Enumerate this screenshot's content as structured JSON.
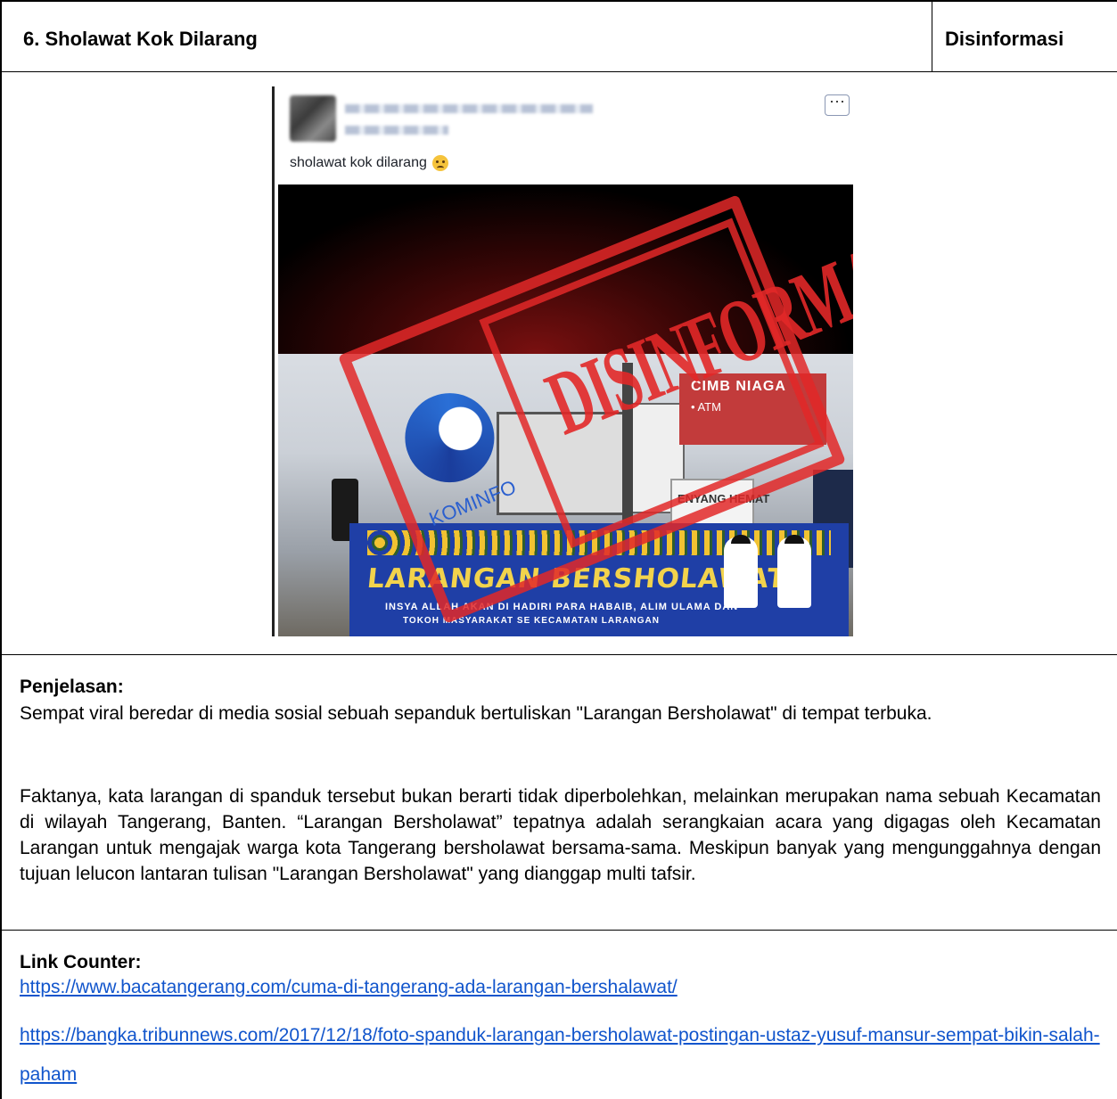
{
  "header": {
    "title": "6. Sholawat Kok Dilarang",
    "label": "Disinformasi"
  },
  "image": {
    "caption": "sholawat kok dilarang",
    "stamp_text": "DISINFORMASI",
    "stamp_logo_text": "KOMINFO",
    "bank_sign": "CIMB NIAGA",
    "atm_text": "• ATM",
    "shop_sign": "ENYANG HEMAT",
    "banner_title": "LARANGAN BERSHOLAWAT",
    "banner_sub": "INSYA ALLAH AKAN DI HADIRI PARA HABAIB, ALIM ULAMA DAN",
    "banner_sub2": "TOKOH MASYARAKAT SE KECAMATAN LARANGAN"
  },
  "explanation": {
    "heading": "Penjelasan:",
    "paragraphs": [
      "Sempat viral beredar di media sosial sebuah sepanduk bertuliskan \"Larangan Bersholawat\" di tempat terbuka.",
      "Faktanya, kata larangan di spanduk tersebut bukan berarti tidak diperbolehkan, melainkan merupakan nama sebuah Kecamatan di wilayah Tangerang, Banten. “Larangan Bersholawat” tepatnya adalah serangkaian acara yang digagas oleh Kecamatan Larangan untuk mengajak warga kota Tangerang bersholawat bersama-sama. Meskipun banyak yang mengunggahnya dengan tujuan lelucon lantaran tulisan \"Larangan Bersholawat\" yang dianggap multi tafsir."
    ]
  },
  "counter": {
    "heading": "Link Counter:",
    "links": [
      "https://www.bacatangerang.com/cuma-di-tangerang-ada-larangan-bershalawat/",
      "https://bangka.tribunnews.com/2017/12/18/foto-spanduk-larangan-bersholawat-postingan-ustaz-yusuf-mansur-sempat-bikin-salah-paham"
    ]
  }
}
